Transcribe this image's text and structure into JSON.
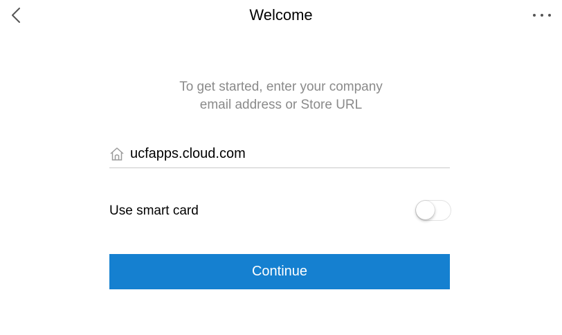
{
  "nav": {
    "title": "Welcome",
    "back_icon": "chevron-left-icon",
    "more_icon": "more-horizontal-icon"
  },
  "intro": {
    "line1": "To get started, enter your company",
    "line2": "email address or Store URL"
  },
  "url_field": {
    "icon": "home-icon",
    "value": "ucfapps.cloud.com"
  },
  "smart_card": {
    "label": "Use smart card",
    "enabled": false
  },
  "continue_button": {
    "label": "Continue"
  },
  "colors": {
    "accent": "#1580d0",
    "subtitle_text": "#8a8a8a",
    "divider": "#c8c8c8"
  }
}
